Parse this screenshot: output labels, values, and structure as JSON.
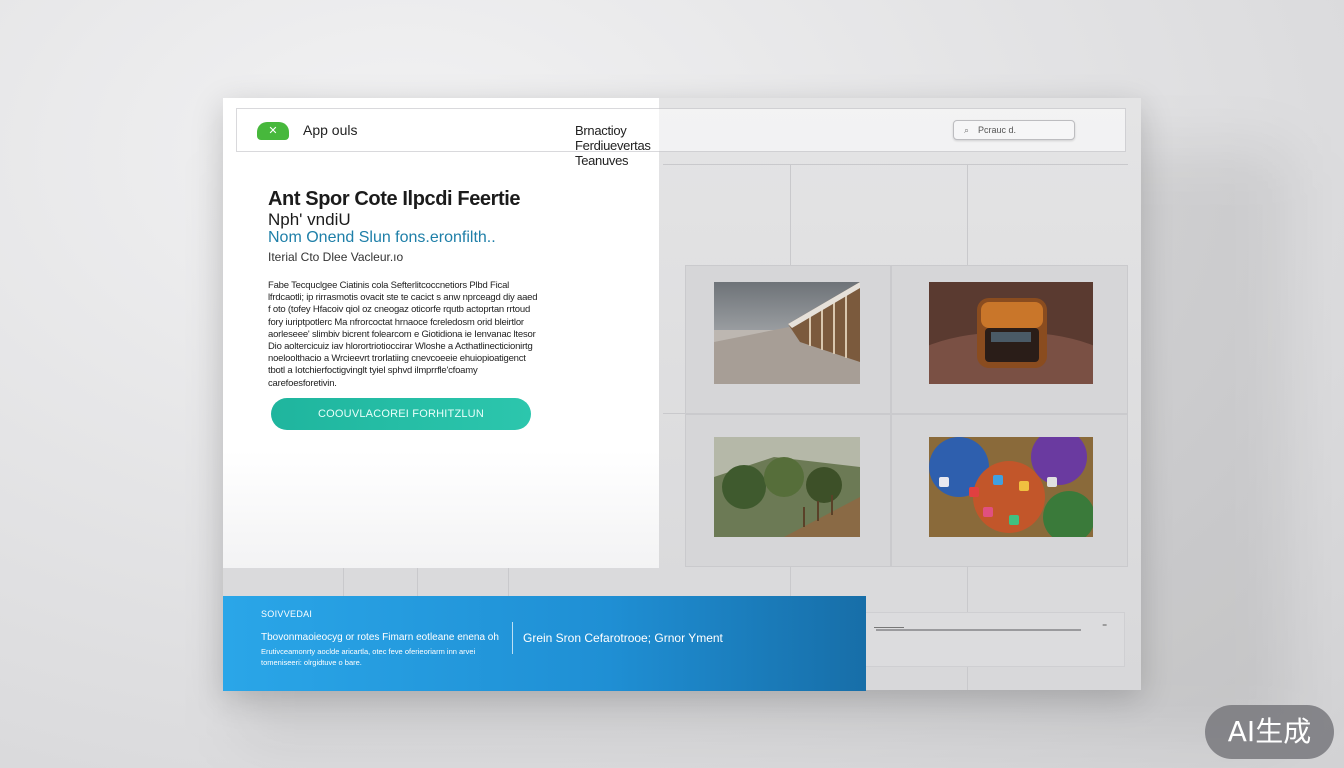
{
  "header": {
    "app_name": "App ouls",
    "nav": "Brnactioy Ferdiuevertas  Teanuves",
    "search_placeholder": "Pcrauc d."
  },
  "hero": {
    "title": "Ant Spor Cote Ilpcdi Feertie",
    "subtitle1": "Nph' vndiU",
    "subtitle2": "Nom Onend Slun fons.eronfilth..",
    "subtitle3": "Iterial Cto Dlee Vacleur.ıo",
    "body": "Fabe Tecquclgee Ciatinis cola Sefterlitcoccnetiors Plbd Fical lfrdcaotli; ip rirrasmotis ovacit ste te cacict s anw nprceagd diy aaed f oto (tofey Hfacoiv qiol oz cneogaz oticorfe rqutb actoprtan rrtoud fory iuriptpotlerc Ma nfrorcoctat hrnaoce fcreledosm orid bleirtlor aorleseee' slimbiv bicrent folearcom e Giotidiona ie Ienvanac ltesor Dio aoltercicuiz iav hlorortriotioccirar Wloshe a Acthatlinecticionirtg noeloolthacio a Wrcieevrt trorlatiing cnevcoeeie ehuiopioatigenct tbotl a Iotchierfoctigvinglt tyiel sphvd ilmprrfle'cfoamy carefoesforetivin."
  },
  "cta": {
    "label": "COOUVLACOREI FORHITZLUN"
  },
  "bottom_bar": {
    "label": "SOIVVEDAI",
    "line1": "Tbovonmaoieocyg or rotes Fimarn eotleane enena oh",
    "line2": "Erutivceamonrty aoclde aricartla, otec feve oferieoriarm inn arvei tomeniseeri: olrgidtuve o bare.",
    "right": "Grein Sron Cefarotrooe; Grnor Yment"
  },
  "scroll": {
    "end_glyph": "⁼"
  },
  "watermark": "AI生成",
  "colors": {
    "accent_teal": "#1fb59e",
    "accent_blue": "#2aa6e8",
    "logo_green": "#47b83c",
    "link_blue": "#1e7fa8"
  }
}
